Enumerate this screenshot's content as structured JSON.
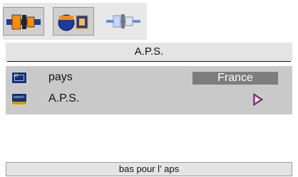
{
  "toolbar": {
    "tabs": [
      {
        "icon": "connector-icon",
        "selected": true
      },
      {
        "icon": "tuner-knob-icon",
        "selected": true
      },
      {
        "icon": "connector-plug-icon",
        "selected": false
      }
    ]
  },
  "title": "A.P.S.",
  "menu": {
    "items": [
      {
        "label": "pays",
        "value": "France",
        "icon": "screen-icon"
      },
      {
        "label": "A.P.S.",
        "icon": "search-screen-icon"
      }
    ]
  },
  "status": {
    "text": "bas pour l' aps"
  },
  "colors": {
    "accent_orange": "#ff8c00",
    "highlight_blue": "#1e90ff",
    "arrow_pink": "#d65aa6"
  }
}
